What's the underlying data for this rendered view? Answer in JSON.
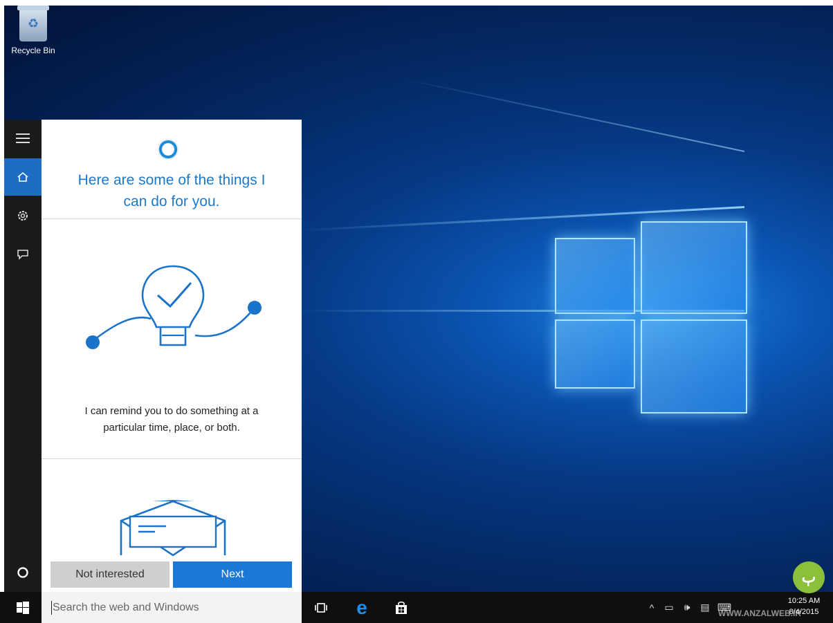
{
  "desktop": {
    "recycle_bin_label": "Recycle Bin"
  },
  "cortana": {
    "headline_line1": "Here are some of the things I",
    "headline_line2": "can do for you.",
    "remind_line1": "I can remind you to do something at a",
    "remind_line2": "particular time, place, or both.",
    "not_interested_label": "Not interested",
    "next_label": "Next",
    "accent_color": "#1b78d6"
  },
  "rail": {
    "icons": [
      "hamburger-menu-icon",
      "home-icon",
      "settings-icon",
      "feedback-icon",
      "cortana-circle-icon"
    ]
  },
  "taskbar": {
    "search_placeholder": "Search the web and Windows",
    "clock_time": "10:25 AM",
    "clock_date": "8/4/2015",
    "watermark_text": "WWW.ANZALWEB.IR"
  }
}
